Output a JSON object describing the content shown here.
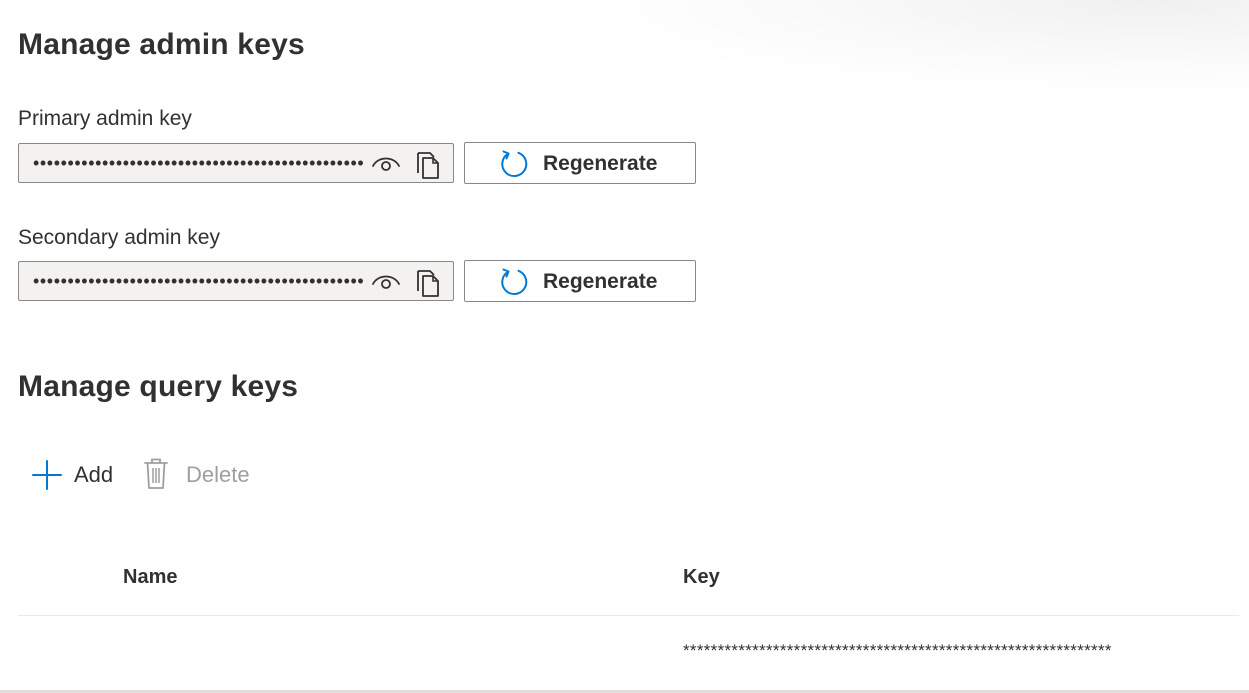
{
  "admin_section": {
    "title": "Manage admin keys",
    "primary": {
      "label": "Primary admin key",
      "masked_value": "••••••••••••••••••••••••••••••••••••••••••••••••",
      "regenerate_label": "Regenerate"
    },
    "secondary": {
      "label": "Secondary admin key",
      "masked_value": "••••••••••••••••••••••••••••••••••••••••••••••••",
      "regenerate_label": "Regenerate"
    }
  },
  "query_section": {
    "title": "Manage query keys",
    "toolbar": {
      "add_label": "Add",
      "delete_label": "Delete"
    },
    "table": {
      "columns": [
        "Name",
        "Key"
      ],
      "rows": [
        {
          "name": "",
          "key": "**************************************************************"
        }
      ]
    }
  },
  "icons": {
    "eye": "eye-icon",
    "copy": "copy-icon",
    "regenerate": "refresh-icon",
    "add": "plus-icon",
    "delete": "trash-icon"
  },
  "colors": {
    "accent": "#0078d4",
    "text": "#323130",
    "disabled_text": "#a19f9d",
    "field_bg": "#f3f2f1",
    "border": "#8a8886"
  }
}
